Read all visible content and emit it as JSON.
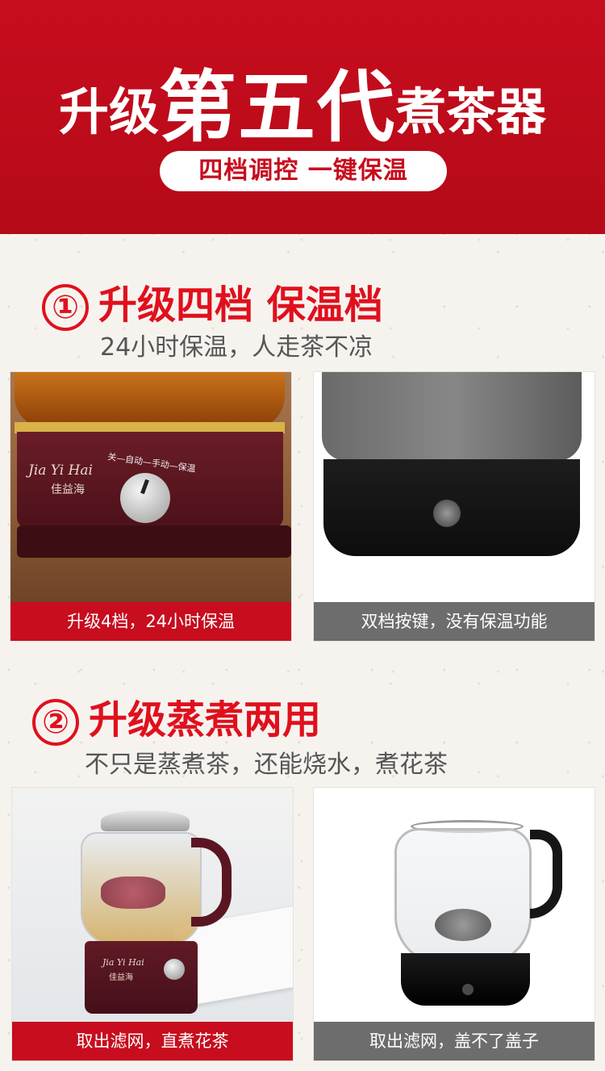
{
  "header": {
    "title_prefix": "升级",
    "title_main": "第五代",
    "title_suffix": "煮茶器",
    "pill_text": "四档调控  一键保温"
  },
  "section1": {
    "number": "①",
    "title": "升级四档 保温档",
    "subtitle": "24小时保温，人走茶不凉",
    "left_caption": "升级4档，24小时保温",
    "right_caption": "双档按键，没有保温功能",
    "brand": "Jia Yi Hai",
    "brand_cn": "佳益海",
    "dial_labels": "关—自动—手动—保温"
  },
  "section2": {
    "number": "②",
    "title": "升级蒸煮两用",
    "subtitle": "不只是蒸煮茶，还能烧水，煮花茶",
    "left_caption": "取出滤网，直煮花茶",
    "right_caption": "取出滤网，盖不了盖子",
    "brand": "Jia Yi Hai",
    "brand_cn": "佳益海"
  },
  "colors": {
    "brand_red": "#c70d1e",
    "grey_caption": "#6d6d6d"
  }
}
